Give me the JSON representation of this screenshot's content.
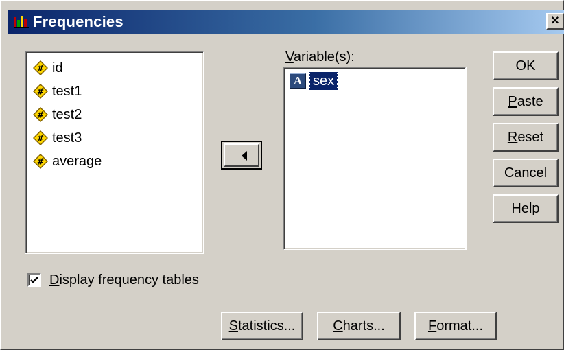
{
  "window": {
    "title": "Frequencies",
    "close_glyph": "×"
  },
  "source_list": {
    "items": [
      {
        "label": "id",
        "icon": "numeric-variable-icon"
      },
      {
        "label": "test1",
        "icon": "numeric-variable-icon"
      },
      {
        "label": "test2",
        "icon": "numeric-variable-icon"
      },
      {
        "label": "test3",
        "icon": "numeric-variable-icon"
      },
      {
        "label": "average",
        "icon": "numeric-variable-icon"
      }
    ]
  },
  "target_list": {
    "label_mnemonic": "V",
    "label_rest": "ariable(s):",
    "items": [
      {
        "label": "sex",
        "icon": "string-variable-icon",
        "icon_glyph": "A",
        "selected": true
      }
    ]
  },
  "buttons": {
    "ok": {
      "label": "OK"
    },
    "paste": {
      "mnemonic": "P",
      "rest": "aste"
    },
    "reset": {
      "mnemonic": "R",
      "rest": "eset"
    },
    "cancel": {
      "label": "Cancel"
    },
    "help": {
      "label": "Help"
    },
    "statistics": {
      "mnemonic": "S",
      "rest": "tatistics..."
    },
    "charts": {
      "mnemonic": "C",
      "rest": "harts..."
    },
    "format": {
      "mnemonic": "F",
      "rest": "ormat..."
    }
  },
  "display_frequency_tables": {
    "checked": true,
    "mnemonic": "D",
    "rest": "isplay frequency tables",
    "check_glyph": "✔"
  },
  "colors": {
    "titlebar_start": "#0a246a",
    "titlebar_end": "#a6caf0",
    "numeric_icon_fill": "#ffd700",
    "selection": "#0a246a",
    "face": "#d4d0c8"
  }
}
